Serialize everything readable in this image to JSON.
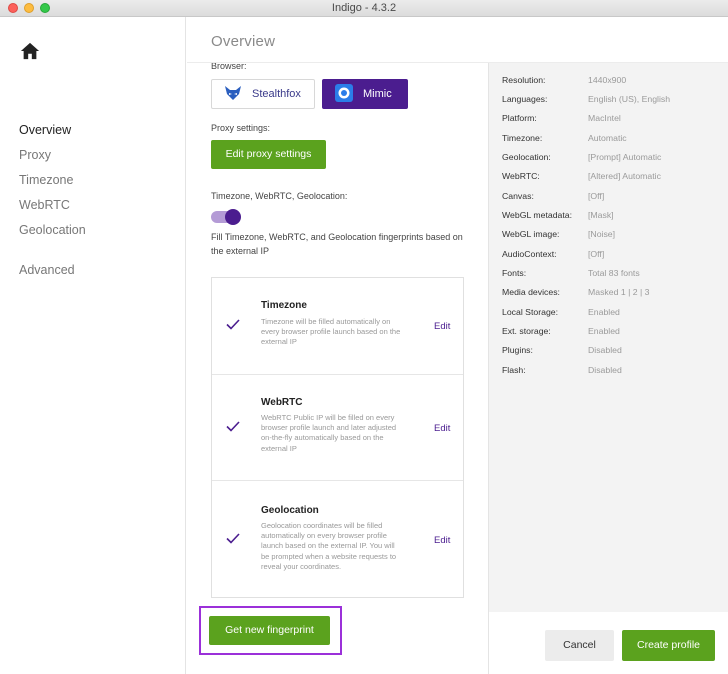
{
  "window": {
    "title": "Indigo - 4.3.2"
  },
  "sidebar": {
    "home_icon": "home-icon",
    "items": [
      {
        "label": "Overview",
        "active": true
      },
      {
        "label": "Proxy",
        "active": false
      },
      {
        "label": "Timezone",
        "active": false
      },
      {
        "label": "WebRTC",
        "active": false
      },
      {
        "label": "Geolocation",
        "active": false
      },
      {
        "label": "Advanced",
        "active": false
      }
    ]
  },
  "header": {
    "title": "Overview"
  },
  "browser": {
    "label": "Browser:",
    "options": [
      {
        "label": "Stealthfox",
        "icon": "fox-icon",
        "selected": false
      },
      {
        "label": "Mimic",
        "icon": "mimic-icon",
        "selected": true
      }
    ]
  },
  "proxy": {
    "label": "Proxy settings:",
    "button": "Edit proxy settings"
  },
  "tz_webrtc_geo": {
    "label": "Timezone, WebRTC, Geolocation:",
    "toggle_on": true,
    "description": "Fill Timezone, WebRTC, and Geolocation fingerprints based on the external IP",
    "cards": [
      {
        "title": "Timezone",
        "desc": "Timezone will be filled automatically on every browser profile launch based on the external IP",
        "edit": "Edit"
      },
      {
        "title": "WebRTC",
        "desc": "WebRTC Public IP will be filled on every browser profile launch and later adjusted on-the-fly automatically based on the external IP",
        "edit": "Edit"
      },
      {
        "title": "Geolocation",
        "desc": "Geolocation coordinates will be filled automatically on every browser profile launch based on the external IP. You will be prompted when a website requests to reveal your coordinates.",
        "edit": "Edit"
      }
    ]
  },
  "fingerprint_button": "Get new fingerprint",
  "summary": [
    {
      "key": "Resolution:",
      "value": "1440x900"
    },
    {
      "key": "Languages:",
      "value": "English (US), English"
    },
    {
      "key": "Platform:",
      "value": "MacIntel"
    },
    {
      "key": "Timezone:",
      "value": "Automatic"
    },
    {
      "key": "Geolocation:",
      "value": "[Prompt] Automatic"
    },
    {
      "key": "WebRTC:",
      "value": "[Altered] Automatic"
    },
    {
      "key": "Canvas:",
      "value": "[Off]"
    },
    {
      "key": "WebGL metadata:",
      "value": "[Mask]"
    },
    {
      "key": "WebGL image:",
      "value": "[Noise]"
    },
    {
      "key": "AudioContext:",
      "value": "[Off]"
    },
    {
      "key": "Fonts:",
      "value": "Total 83 fonts"
    },
    {
      "key": "Media devices:",
      "value": "Masked 1 | 2 | 3"
    },
    {
      "key": "Local Storage:",
      "value": "Enabled"
    },
    {
      "key": "Ext. storage:",
      "value": "Enabled"
    },
    {
      "key": "Plugins:",
      "value": "Disabled"
    },
    {
      "key": "Flash:",
      "value": "Disabled"
    }
  ],
  "footer": {
    "cancel": "Cancel",
    "create": "Create profile"
  },
  "colors": {
    "accent_purple": "#4b1d8f",
    "accent_green": "#5ba21e",
    "highlight_border": "#9b30d9"
  }
}
